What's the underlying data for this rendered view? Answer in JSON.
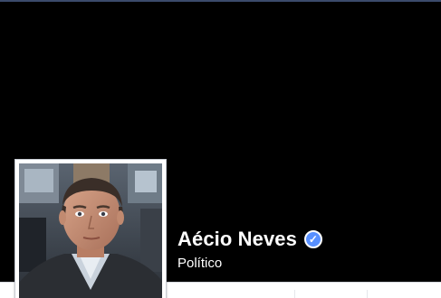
{
  "profile": {
    "name": "Aécio Neves",
    "category": "Político",
    "verified_icon": "verified-check-icon",
    "verified_color": "#5890ff"
  },
  "cover": {
    "color": "#000000"
  }
}
